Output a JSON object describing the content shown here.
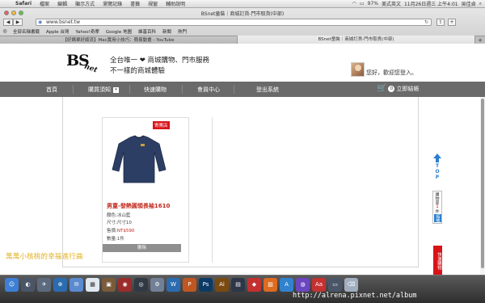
{
  "menubar": {
    "apple": "",
    "app": "Safari",
    "items": [
      "檔案",
      "編輯",
      "顯示方式",
      "瀏覽記錄",
      "書籤",
      "視窗",
      "輔助說明"
    ],
    "status": {
      "battery": "97%",
      "input": "美式英文",
      "datetime": "11月26日週三 上午4:01",
      "user": "吳佳貞"
    }
  },
  "browser": {
    "window_title": "BSnet童裝｜商城訂貨-門市取貨(中部)",
    "url": "www.bsnet.tw",
    "bookmarks": [
      "全部名稱書籤",
      "Apple 台灣",
      "Yahoo!奇摩",
      "Google 地圖",
      "維基百科",
      "新聞",
      "熱門"
    ],
    "tabs": [
      {
        "label": "【好媽單好綾流】Mac實用小技巧：簡易動畫 - YouTube",
        "active": false
      },
      {
        "label": "BSnet童裝｜商城訂貨-門市取貨(中部)",
        "active": true
      }
    ]
  },
  "site": {
    "logo_bs": "BS",
    "logo_net": "net",
    "slogan1": "全台唯一 ❤ 商城購物、門市服務",
    "slogan2": "不一樣的商城體驗",
    "welcome": "您好，歡迎您登入。",
    "nav": {
      "home": "首頁",
      "purchase": "購買須知",
      "order": "快速購物",
      "member": "會員中心",
      "logout": "登出系統",
      "checkout": "立即結帳",
      "cart_count": "0"
    }
  },
  "product": {
    "badge": "寄賣店",
    "name": "男童-發熱圓領長袖1610",
    "color": "顏色:冰山藍",
    "size": "尺寸:尺寸10",
    "price_label": "售價:",
    "price": "NT$590",
    "qty": "數量:1件",
    "delete": "刪除"
  },
  "side": {
    "top": "TOP",
    "cart_label": "購物車",
    "cart_num": "1",
    "cart_unit": "件",
    "checkout": "結帳",
    "quick_buy": "快速購物"
  },
  "overlay": {
    "handwritten": "萬萬小核桃的幸福進行曲",
    "watermark": "http://alrena.pixnet.net/album"
  }
}
